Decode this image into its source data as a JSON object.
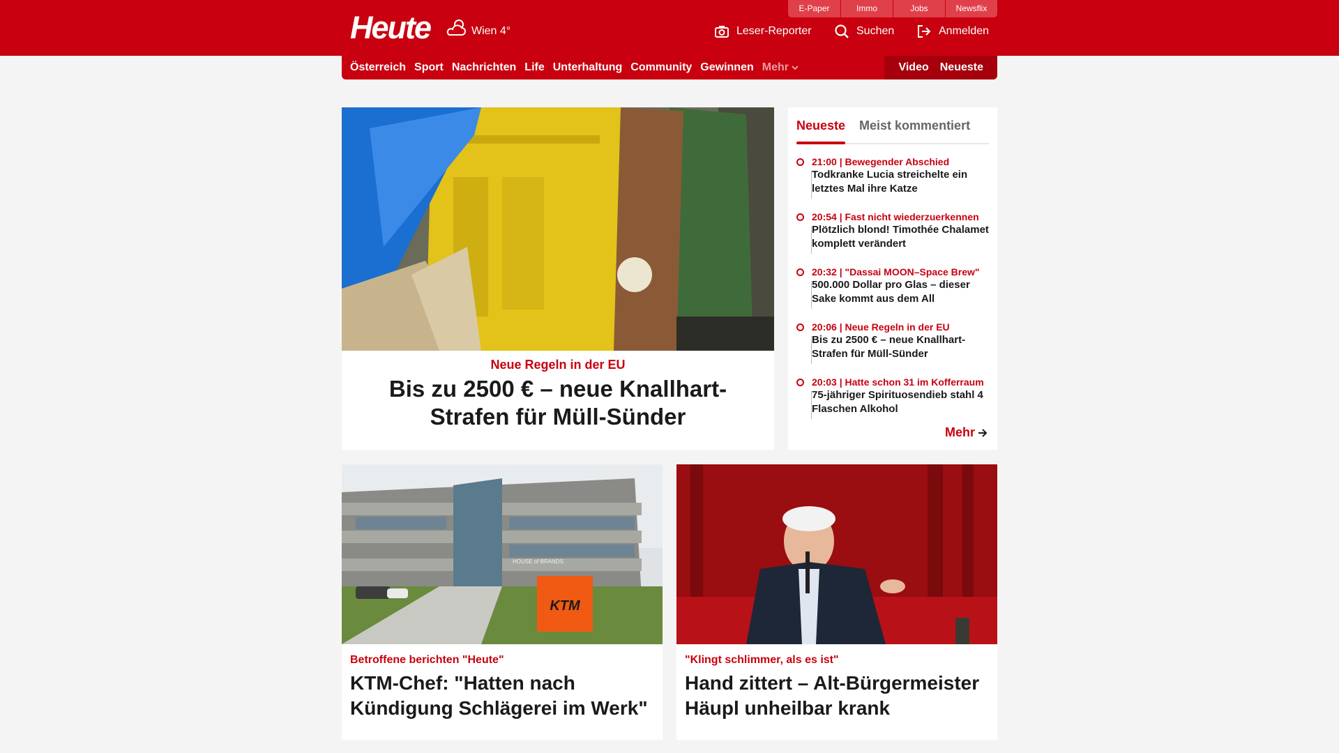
{
  "header": {
    "logo": "Heute",
    "weather": "Wien 4°",
    "quicklinks": [
      "E-Paper",
      "Immo",
      "Jobs",
      "Newsflix"
    ],
    "actions": {
      "reporter": "Leser-Reporter",
      "search": "Suchen",
      "login": "Anmelden"
    }
  },
  "nav": {
    "items": [
      "Österreich",
      "Sport",
      "Nachrichten",
      "Life",
      "Unterhaltung",
      "Community",
      "Gewinnen"
    ],
    "more": "Mehr",
    "right": [
      "Video",
      "Neueste"
    ]
  },
  "hero": {
    "kicker": "Neue Regeln in der EU",
    "title": "Bis zu 2500 € – neue Knallhart-Strafen für Müll-Sünder"
  },
  "sidebar": {
    "tabs": [
      "Neueste",
      "Meist kommentiert"
    ],
    "items": [
      {
        "meta": "21:00 | Bewegender Abschied",
        "title": "Todkranke Lucia streichelte ein letztes Mal ihre Katze"
      },
      {
        "meta": "20:54 | Fast nicht wiederzuerkennen",
        "title": "Plötzlich blond! Timothée Chalamet komplett verändert"
      },
      {
        "meta": "20:32 | \"Dassai MOON–Space Brew\"",
        "title": "500.000 Dollar pro Glas – dieser Sake kommt aus dem All"
      },
      {
        "meta": "20:06 | Neue Regeln in der EU",
        "title": "Bis zu 2500 € – neue Knallhart-Strafen für Müll-Sünder"
      },
      {
        "meta": "20:03 | Hatte schon 31 im Kofferraum",
        "title": "75-jähriger Spirituosendieb stahl 4 Flaschen Alkohol"
      }
    ],
    "more": "Mehr"
  },
  "cards": [
    {
      "kicker": "Betroffene berichten \"Heute\"",
      "title": "KTM-Chef: \"Hatten nach Kündigung Schlägerei im Werk\"",
      "sign_text": "KTM",
      "building_text": "HOUSE of BRANDS"
    },
    {
      "kicker": "\"Klingt schlimmer, als es ist\"",
      "title": "Hand zittert – Alt-Bürgermeister Häupl unheilbar krank"
    }
  ],
  "colors": {
    "brand": "#c8000f",
    "brand_dark": "#a5000c",
    "background": "#f4f4f4"
  }
}
